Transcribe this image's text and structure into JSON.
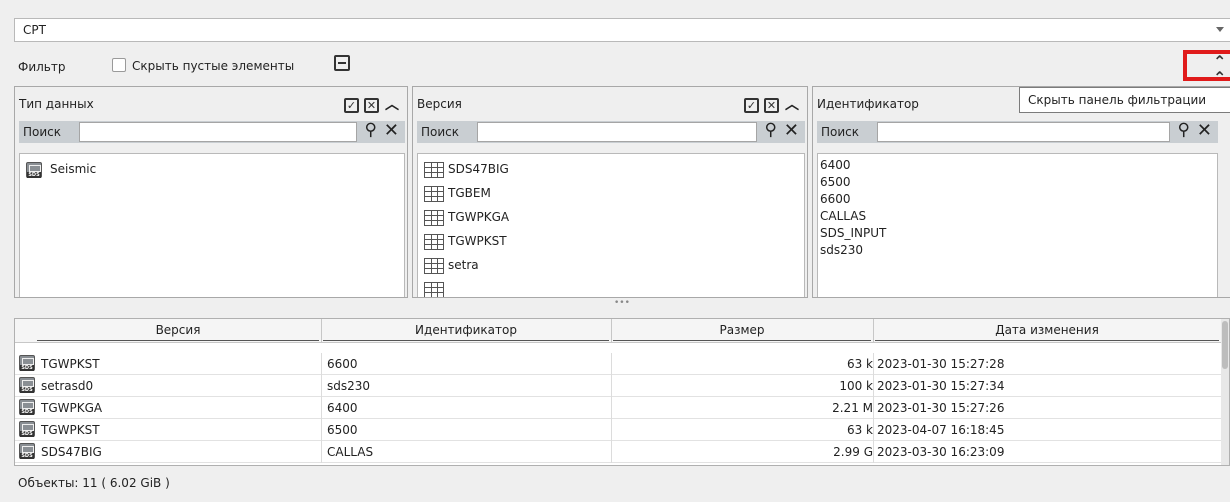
{
  "combo": {
    "value": "CPT"
  },
  "filter": {
    "label": "Фильтр",
    "hide_empty_label": "Скрыть пустые элементы",
    "hide_empty_checked": false
  },
  "tooltip": {
    "text": "Скрыть панель фильтрации"
  },
  "panels": {
    "data_type": {
      "title": "Тип данных",
      "search_label": "Поиск",
      "search_value": "",
      "items": [
        "Seismic"
      ]
    },
    "version": {
      "title": "Версия",
      "search_label": "Поиск",
      "search_value": "",
      "items": [
        "SDS47BIG",
        "TGBEM",
        "TGWPKGA",
        "TGWPKST",
        "setra"
      ]
    },
    "identifier": {
      "title": "Идентификатор",
      "search_label": "Поиск",
      "search_value": "",
      "items": [
        "6400",
        "6500",
        "6600",
        "CALLAS",
        "SDS_INPUT",
        "sds230"
      ]
    }
  },
  "splitter": {
    "handle": "•••"
  },
  "table": {
    "columns": [
      "Версия",
      "Идентификатор",
      "Размер",
      "Дата изменения"
    ],
    "rows": [
      {
        "version": "TGWPKST",
        "id": "6600",
        "size": "63 k",
        "date": "2023-01-30 15:27:28"
      },
      {
        "version": "setrasd0",
        "id": "sds230",
        "size": "100 k",
        "date": "2023-01-30 15:27:34"
      },
      {
        "version": "TGWPKGA",
        "id": "6400",
        "size": "2.21 M",
        "date": "2023-01-30 15:27:26"
      },
      {
        "version": "TGWPKST",
        "id": "6500",
        "size": "63 k",
        "date": "2023-04-07 16:18:45"
      },
      {
        "version": "SDS47BIG",
        "id": "CALLAS",
        "size": "2.99 G",
        "date": "2023-03-30 16:23:09"
      }
    ]
  },
  "status": {
    "text": "Объекты: 11 ( 6.02 GiB )"
  },
  "colors": {
    "highlight": "#e01b1b",
    "search_bar": "#c9ced2"
  }
}
